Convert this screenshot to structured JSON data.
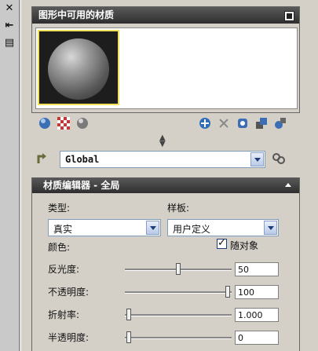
{
  "left_strip": {
    "icons": [
      "close-icon",
      "pin-icon",
      "properties-icon"
    ],
    "glyphs": [
      "✕",
      "⇤",
      "▤"
    ]
  },
  "materials_panel": {
    "title": "图形中可用的材质",
    "selected_swatch": "sphere"
  },
  "toolbar": {
    "left_icons": [
      "swatch-geometry-icon",
      "checker-background-icon",
      "sphere-preview-icon"
    ],
    "right_icons": [
      "create-material-icon",
      "purge-icon",
      "apply-to-objects-icon",
      "export-to-palette-icon",
      "material-options-icon"
    ]
  },
  "global_row": {
    "value": "Global"
  },
  "editor": {
    "title": "材质编辑器 - 全局",
    "type_label": "类型:",
    "type_value": "真实",
    "template_label": "样板:",
    "template_value": "用户定义",
    "color_label": "颜色:",
    "by_object_label": "随对象",
    "by_object_checked": true,
    "rows": [
      {
        "label": "反光度:",
        "value": "50",
        "position": 0.5
      },
      {
        "label": "不透明度:",
        "value": "100",
        "position": 1.0
      },
      {
        "label": "折射率:",
        "value": "1.000",
        "position": 0.0
      },
      {
        "label": "半透明度:",
        "value": "0",
        "position": 0.0
      }
    ]
  }
}
